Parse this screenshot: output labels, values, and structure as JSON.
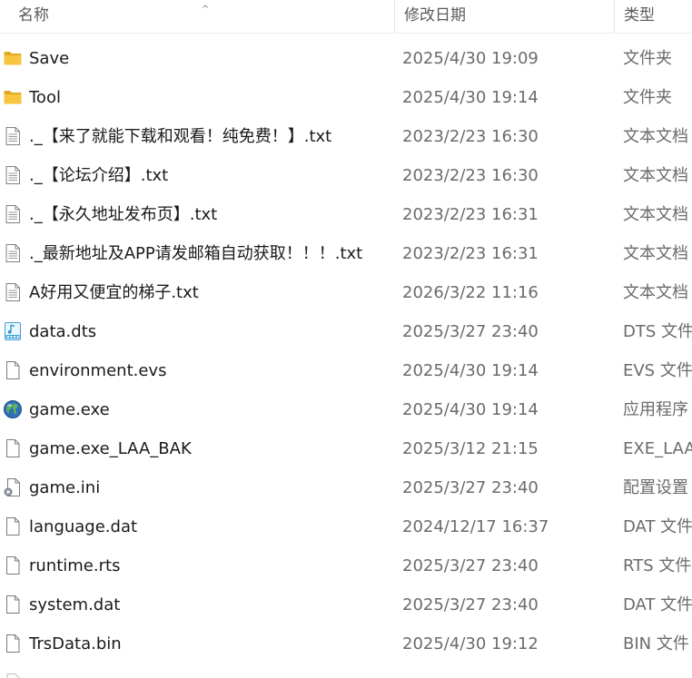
{
  "columns": {
    "name": "名称",
    "date": "修改日期",
    "type": "类型"
  },
  "files": [
    {
      "icon": "folder-icon",
      "name": "Save",
      "date": "2025/4/30 19:09",
      "type": "文件夹"
    },
    {
      "icon": "folder-icon",
      "name": "Tool",
      "date": "2025/4/30 19:14",
      "type": "文件夹"
    },
    {
      "icon": "text-file-icon",
      "name": "._【来了就能下载和观看！纯免费！】.txt",
      "date": "2023/2/23 16:30",
      "type": "文本文档"
    },
    {
      "icon": "text-file-icon",
      "name": "._【论坛介绍】.txt",
      "date": "2023/2/23 16:30",
      "type": "文本文档"
    },
    {
      "icon": "text-file-icon",
      "name": "._【永久地址发布页】.txt",
      "date": "2023/2/23 16:31",
      "type": "文本文档"
    },
    {
      "icon": "text-file-icon",
      "name": "._最新地址及APP请发邮箱自动获取！！！.txt",
      "date": "2023/2/23 16:31",
      "type": "文本文档"
    },
    {
      "icon": "text-file-icon",
      "name": "A好用又便宜的梯子.txt",
      "date": "2026/3/22 11:16",
      "type": "文本文档"
    },
    {
      "icon": "audio-file-icon",
      "name": "data.dts",
      "date": "2025/3/27 23:40",
      "type": "DTS 文件"
    },
    {
      "icon": "blank-file-icon",
      "name": "environment.evs",
      "date": "2025/4/30 19:14",
      "type": "EVS 文件"
    },
    {
      "icon": "globe-app-icon",
      "name": "game.exe",
      "date": "2025/4/30 19:14",
      "type": "应用程序"
    },
    {
      "icon": "blank-file-icon",
      "name": "game.exe_LAA_BAK",
      "date": "2025/3/12 21:15",
      "type": "EXE_LAA_"
    },
    {
      "icon": "settings-file-icon",
      "name": "game.ini",
      "date": "2025/3/27 23:40",
      "type": "配置设置"
    },
    {
      "icon": "blank-file-icon",
      "name": "language.dat",
      "date": "2024/12/17 16:37",
      "type": "DAT 文件"
    },
    {
      "icon": "blank-file-icon",
      "name": "runtime.rts",
      "date": "2025/3/27 23:40",
      "type": "RTS 文件"
    },
    {
      "icon": "blank-file-icon",
      "name": "system.dat",
      "date": "2025/3/27 23:40",
      "type": "DAT 文件"
    },
    {
      "icon": "blank-file-icon",
      "name": "TrsData.bin",
      "date": "2025/4/30 19:12",
      "type": "BIN 文件"
    }
  ],
  "colors": {
    "folder": "#f8c540",
    "folder_dark": "#e0a820",
    "accent": "#0078d4"
  }
}
